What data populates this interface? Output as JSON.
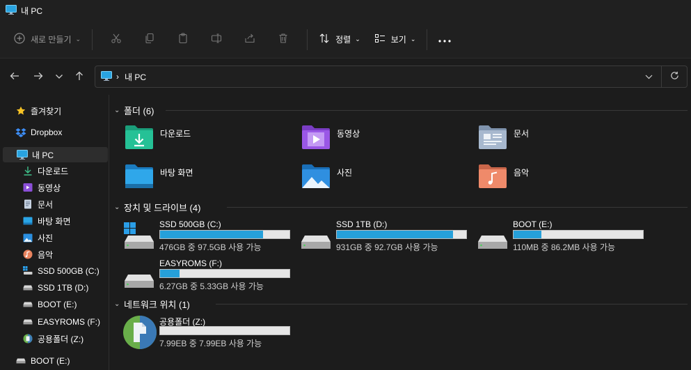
{
  "window": {
    "title": "내 PC"
  },
  "toolbar": {
    "new_label": "새로 만들기",
    "sort_label": "정렬",
    "view_label": "보기"
  },
  "address": {
    "path": "내 PC"
  },
  "sidebar": {
    "items": [
      {
        "label": "즐겨찾기",
        "icon": "star-icon"
      },
      {
        "label": "Dropbox",
        "icon": "dropbox-icon"
      },
      {
        "label": "내 PC",
        "icon": "monitor-icon"
      },
      {
        "label": "다운로드",
        "icon": "download-icon"
      },
      {
        "label": "동영상",
        "icon": "video-icon"
      },
      {
        "label": "문서",
        "icon": "document-icon"
      },
      {
        "label": "바탕 화면",
        "icon": "desktop-icon"
      },
      {
        "label": "사진",
        "icon": "picture-icon"
      },
      {
        "label": "음악",
        "icon": "music-icon"
      },
      {
        "label": "SSD 500GB (C:)",
        "icon": "windows-drive-icon"
      },
      {
        "label": "SSD 1TB (D:)",
        "icon": "drive-icon"
      },
      {
        "label": "BOOT (E:)",
        "icon": "drive-icon"
      },
      {
        "label": "EASYROMS (F:)",
        "icon": "drive-icon"
      },
      {
        "label": "공용폴더 (Z:)",
        "icon": "network-drive-icon"
      },
      {
        "label": "BOOT (E:)",
        "icon": "drive-icon"
      }
    ]
  },
  "sections": {
    "folders": "폴더 (6)",
    "devices": "장치 및 드라이브 (4)",
    "network": "네트워크 위치 (1)"
  },
  "folders": [
    {
      "label": "다운로드",
      "icon": "download-folder-icon"
    },
    {
      "label": "동영상",
      "icon": "video-folder-icon"
    },
    {
      "label": "문서",
      "icon": "document-folder-icon"
    },
    {
      "label": "바탕 화면",
      "icon": "desktop-folder-icon"
    },
    {
      "label": "사진",
      "icon": "picture-folder-icon"
    },
    {
      "label": "음악",
      "icon": "music-folder-icon"
    }
  ],
  "drives": [
    {
      "name": "SSD 500GB (C:)",
      "free": "476GB 중 97.5GB 사용 가능",
      "used_fraction": 0.795
    },
    {
      "name": "SSD 1TB (D:)",
      "free": "931GB 중 92.7GB 사용 가능",
      "used_fraction": 0.9
    },
    {
      "name": "BOOT (E:)",
      "free": "110MB 중 86.2MB 사용 가능",
      "used_fraction": 0.216
    },
    {
      "name": "EASYROMS (F:)",
      "free": "6.27GB 중 5.33GB 사용 가능",
      "used_fraction": 0.15
    }
  ],
  "network_drives": [
    {
      "name": "공용폴더 (Z:)",
      "free": "7.99EB 중 7.99EB 사용 가능",
      "used_fraction": 0.0
    }
  ],
  "colors": {
    "accent": "#26a0da",
    "background": "#1c1c1c",
    "toolbar": "#202020"
  }
}
